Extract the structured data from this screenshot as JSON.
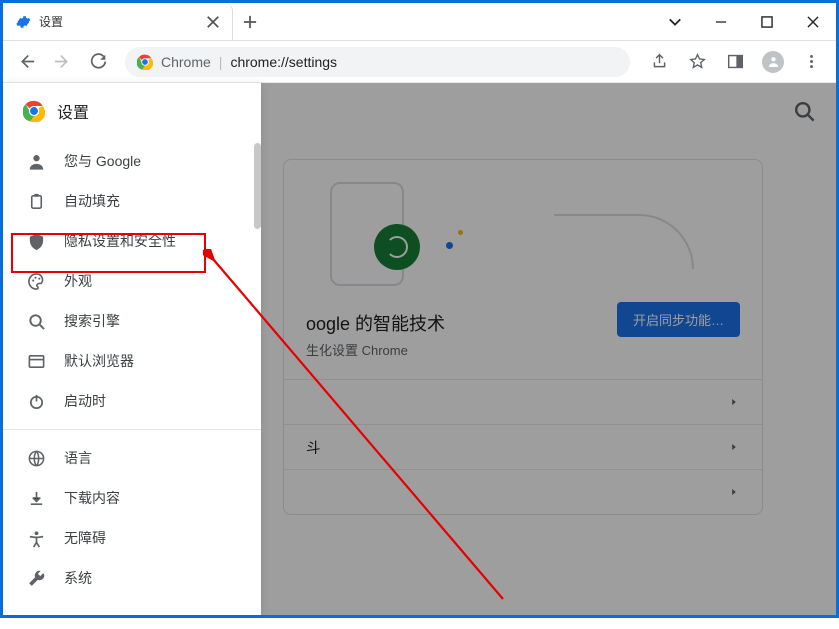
{
  "tab": {
    "title": "设置"
  },
  "address": {
    "protocol": "Chrome",
    "path": "chrome://settings"
  },
  "drawer": {
    "title": "设置",
    "groups": [
      [
        {
          "icon": "person",
          "label": "您与 Google"
        },
        {
          "icon": "clipboard",
          "label": "自动填充"
        },
        {
          "icon": "shield",
          "label": "隐私设置和安全性"
        },
        {
          "icon": "palette",
          "label": "外观"
        },
        {
          "icon": "search",
          "label": "搜索引擎"
        },
        {
          "icon": "browser",
          "label": "默认浏览器"
        },
        {
          "icon": "power",
          "label": "启动时"
        }
      ],
      [
        {
          "icon": "globe",
          "label": "语言"
        },
        {
          "icon": "download",
          "label": "下载内容"
        },
        {
          "icon": "accessibility",
          "label": "无障碍"
        },
        {
          "icon": "wrench",
          "label": "系统"
        }
      ]
    ]
  },
  "backdrop": {
    "card": {
      "heading_fragment": "oogle 的智能技术",
      "sub_fragment": "生化设置 Chrome",
      "cta": "开启同步功能…",
      "row_fragment": "斗"
    }
  }
}
